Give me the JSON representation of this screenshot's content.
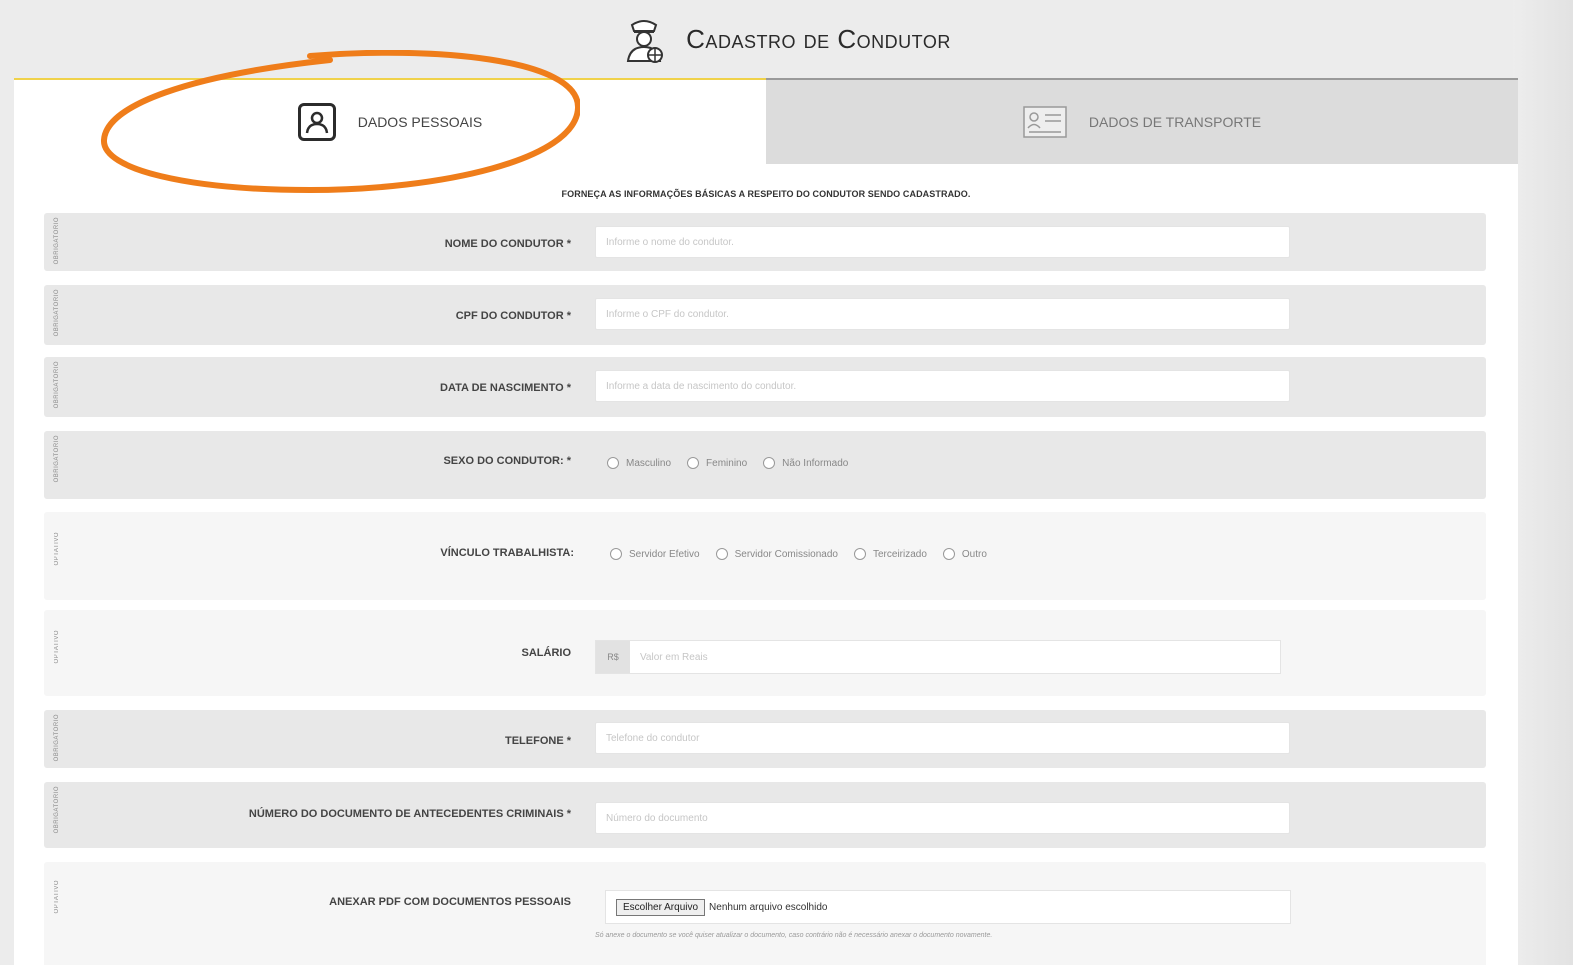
{
  "header": {
    "title": "Cadastro de Condutor",
    "icon": "driver-icon"
  },
  "tabs": [
    {
      "label": "DADOS PESSOAIS",
      "icon": "user-icon",
      "active": true
    },
    {
      "label": "DADOS DE TRANSPORTE",
      "icon": "id-card-icon",
      "active": false
    }
  ],
  "intro": "FORNEÇA AS INFORMAÇÕES BÁSICAS A RESPEITO DO CONDUTOR SENDO CADASTRADO.",
  "tags": {
    "required": "OBRIGATÓRIO",
    "optional": "OPTATIVO"
  },
  "fields": {
    "nome": {
      "label": "NOME DO CONDUTOR *",
      "placeholder": "Informe o nome do condutor."
    },
    "cpf": {
      "label": "CPF DO CONDUTOR *",
      "placeholder": "Informe o CPF do condutor."
    },
    "nascimento": {
      "label": "DATA DE NASCIMENTO *",
      "placeholder": "Informe a data de nascimento do condutor."
    },
    "sexo": {
      "label": "SEXO DO CONDUTOR: *",
      "options": [
        "Masculino",
        "Feminino",
        "Não Informado"
      ]
    },
    "vinculo": {
      "label": "VÍNCULO TRABALHISTA:",
      "options": [
        "Servidor Efetivo",
        "Servidor Comissionado",
        "Terceirizado",
        "Outro"
      ]
    },
    "salario": {
      "label": "SALÁRIO",
      "addon": "R$",
      "placeholder": "Valor em Reais"
    },
    "telefone": {
      "label": "TELEFONE *",
      "placeholder": "Telefone do condutor"
    },
    "antecedentes": {
      "label": "NÚMERO DO DOCUMENTO DE ANTECEDENTES CRIMINAIS *",
      "placeholder": "Número do documento"
    },
    "anexo": {
      "label": "ANEXAR PDF COM DOCUMENTOS PESSOAIS",
      "button": "Escolher Arquivo",
      "status": "Nenhum arquivo escolhido",
      "hint": "Só anexe o documento se você quiser atualizar o documento, caso contrário não é necessário anexar o documento novamente."
    }
  },
  "colors": {
    "accent": "#f0d24a",
    "annotation": "#ef7d1a"
  }
}
